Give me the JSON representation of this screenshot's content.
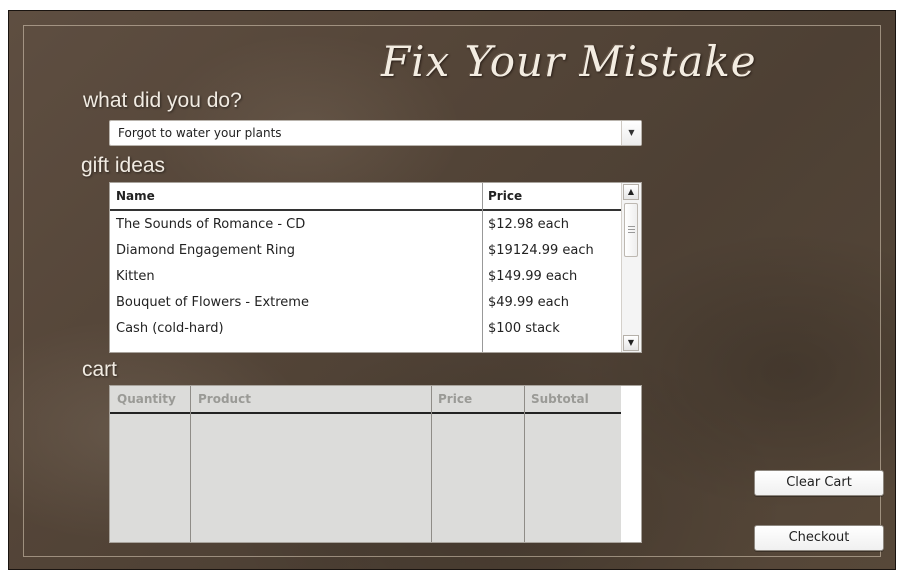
{
  "app": {
    "title": "Fix Your Mistake"
  },
  "sections": {
    "what_label": "what did you do?",
    "gifts_label": "gift ideas",
    "cart_label": "cart"
  },
  "mistake_select": {
    "selected": "Forgot to water your plants"
  },
  "gift_table": {
    "columns": [
      "Name",
      "Price"
    ],
    "rows": [
      {
        "name": "The Sounds of Romance - CD",
        "price": "$12.98 each"
      },
      {
        "name": "Diamond Engagement Ring",
        "price": "$19124.99 each"
      },
      {
        "name": "Kitten",
        "price": "$149.99 each"
      },
      {
        "name": "Bouquet of Flowers - Extreme",
        "price": "$49.99 each"
      },
      {
        "name": "Cash (cold-hard)",
        "price": "$100 stack"
      }
    ]
  },
  "cart_table": {
    "columns": [
      "Quantity",
      "Product",
      "Price",
      "Subtotal"
    ],
    "rows": []
  },
  "buttons": {
    "clear_cart": "Clear Cart",
    "checkout": "Checkout"
  },
  "icons": {
    "dropdown": "chevron-down-icon",
    "scroll_up": "arrow-up-icon",
    "scroll_down": "arrow-down-icon"
  }
}
